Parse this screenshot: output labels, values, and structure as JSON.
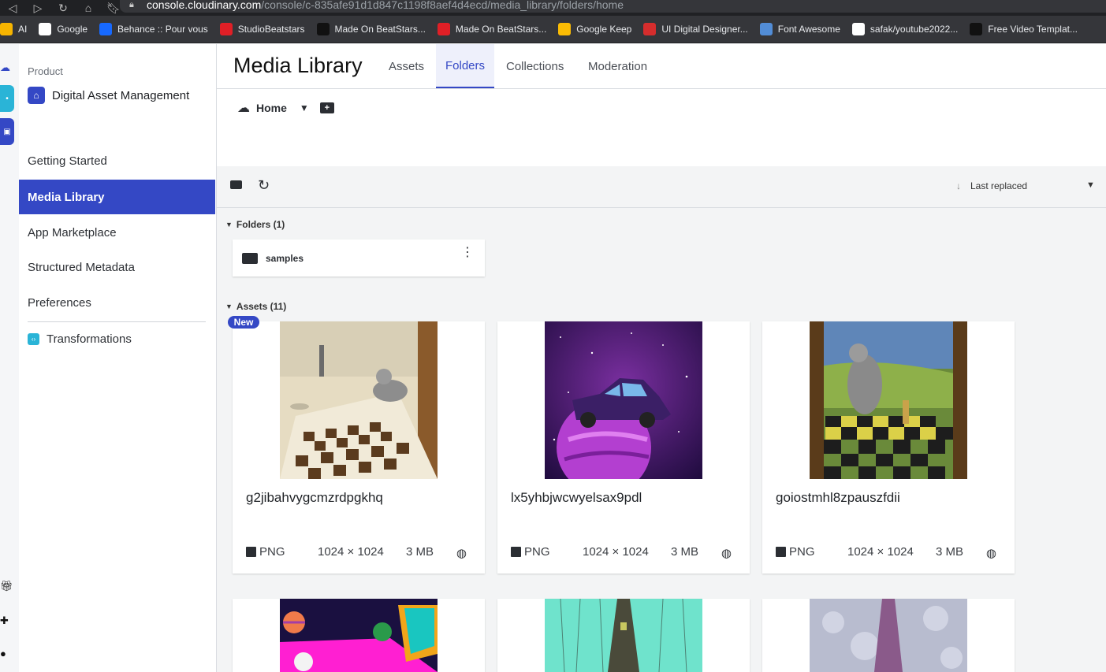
{
  "browser": {
    "url_host": "console.cloudinary.com",
    "url_path": "/console/c-835afe91d1d847c1198f8aef4d4ecd/media_library/folders/home",
    "bookmarks": [
      {
        "label": "AI",
        "color": "#f6b400"
      },
      {
        "label": "Google",
        "color": "#ffffff"
      },
      {
        "label": "Behance :: Pour vous",
        "color": "#1769ff"
      },
      {
        "label": "StudioBeatstars",
        "color": "#e01f26"
      },
      {
        "label": "Made On BeatStars...",
        "color": "#111111"
      },
      {
        "label": "Made On BeatStars...",
        "color": "#e01f26"
      },
      {
        "label": "Google Keep",
        "color": "#fbbc04"
      },
      {
        "label": "UI Digital Designer...",
        "color": "#d62d2d"
      },
      {
        "label": "Font Awesome",
        "color": "#528dd7"
      },
      {
        "label": "safak/youtube2022...",
        "color": "#ffffff"
      },
      {
        "label": "Free Video Templat...",
        "color": "#111111"
      }
    ]
  },
  "sidebar": {
    "product_label": "Product",
    "product_name": "Digital Asset Management",
    "items": [
      {
        "label": "Getting Started",
        "active": false
      },
      {
        "label": "Media Library",
        "active": true
      },
      {
        "label": "App Marketplace",
        "active": false
      },
      {
        "label": "Structured Metadata",
        "active": false
      },
      {
        "label": "Preferences",
        "active": false
      },
      {
        "label": "Transformations",
        "active": false
      }
    ]
  },
  "header": {
    "title": "Media Library",
    "tabs": [
      {
        "label": "Assets",
        "active": false
      },
      {
        "label": "Folders",
        "active": true
      },
      {
        "label": "Collections",
        "active": false
      },
      {
        "label": "Moderation",
        "active": false
      }
    ]
  },
  "breadcrumb": {
    "home": "Home"
  },
  "toolbar": {
    "sort_label": "Last replaced"
  },
  "folders_section": {
    "label": "Folders (1)",
    "items": [
      {
        "name": "samples"
      }
    ]
  },
  "assets_section": {
    "label": "Assets (11)",
    "new_badge": "New",
    "items": [
      {
        "name": "g2jibahvygcmzrdpgkhq",
        "format": "PNG",
        "dimensions": "1024 × 1024",
        "size": "3 MB"
      },
      {
        "name": "lx5yhbjwcwyelsax9pdl",
        "format": "PNG",
        "dimensions": "1024 × 1024",
        "size": "3 MB"
      },
      {
        "name": "goiostmhl8zpauszfdii",
        "format": "PNG",
        "dimensions": "1024 × 1024",
        "size": "3 MB"
      }
    ]
  },
  "colors": {
    "accent": "#3448c5",
    "rail_teal": "#2ab4d7"
  }
}
